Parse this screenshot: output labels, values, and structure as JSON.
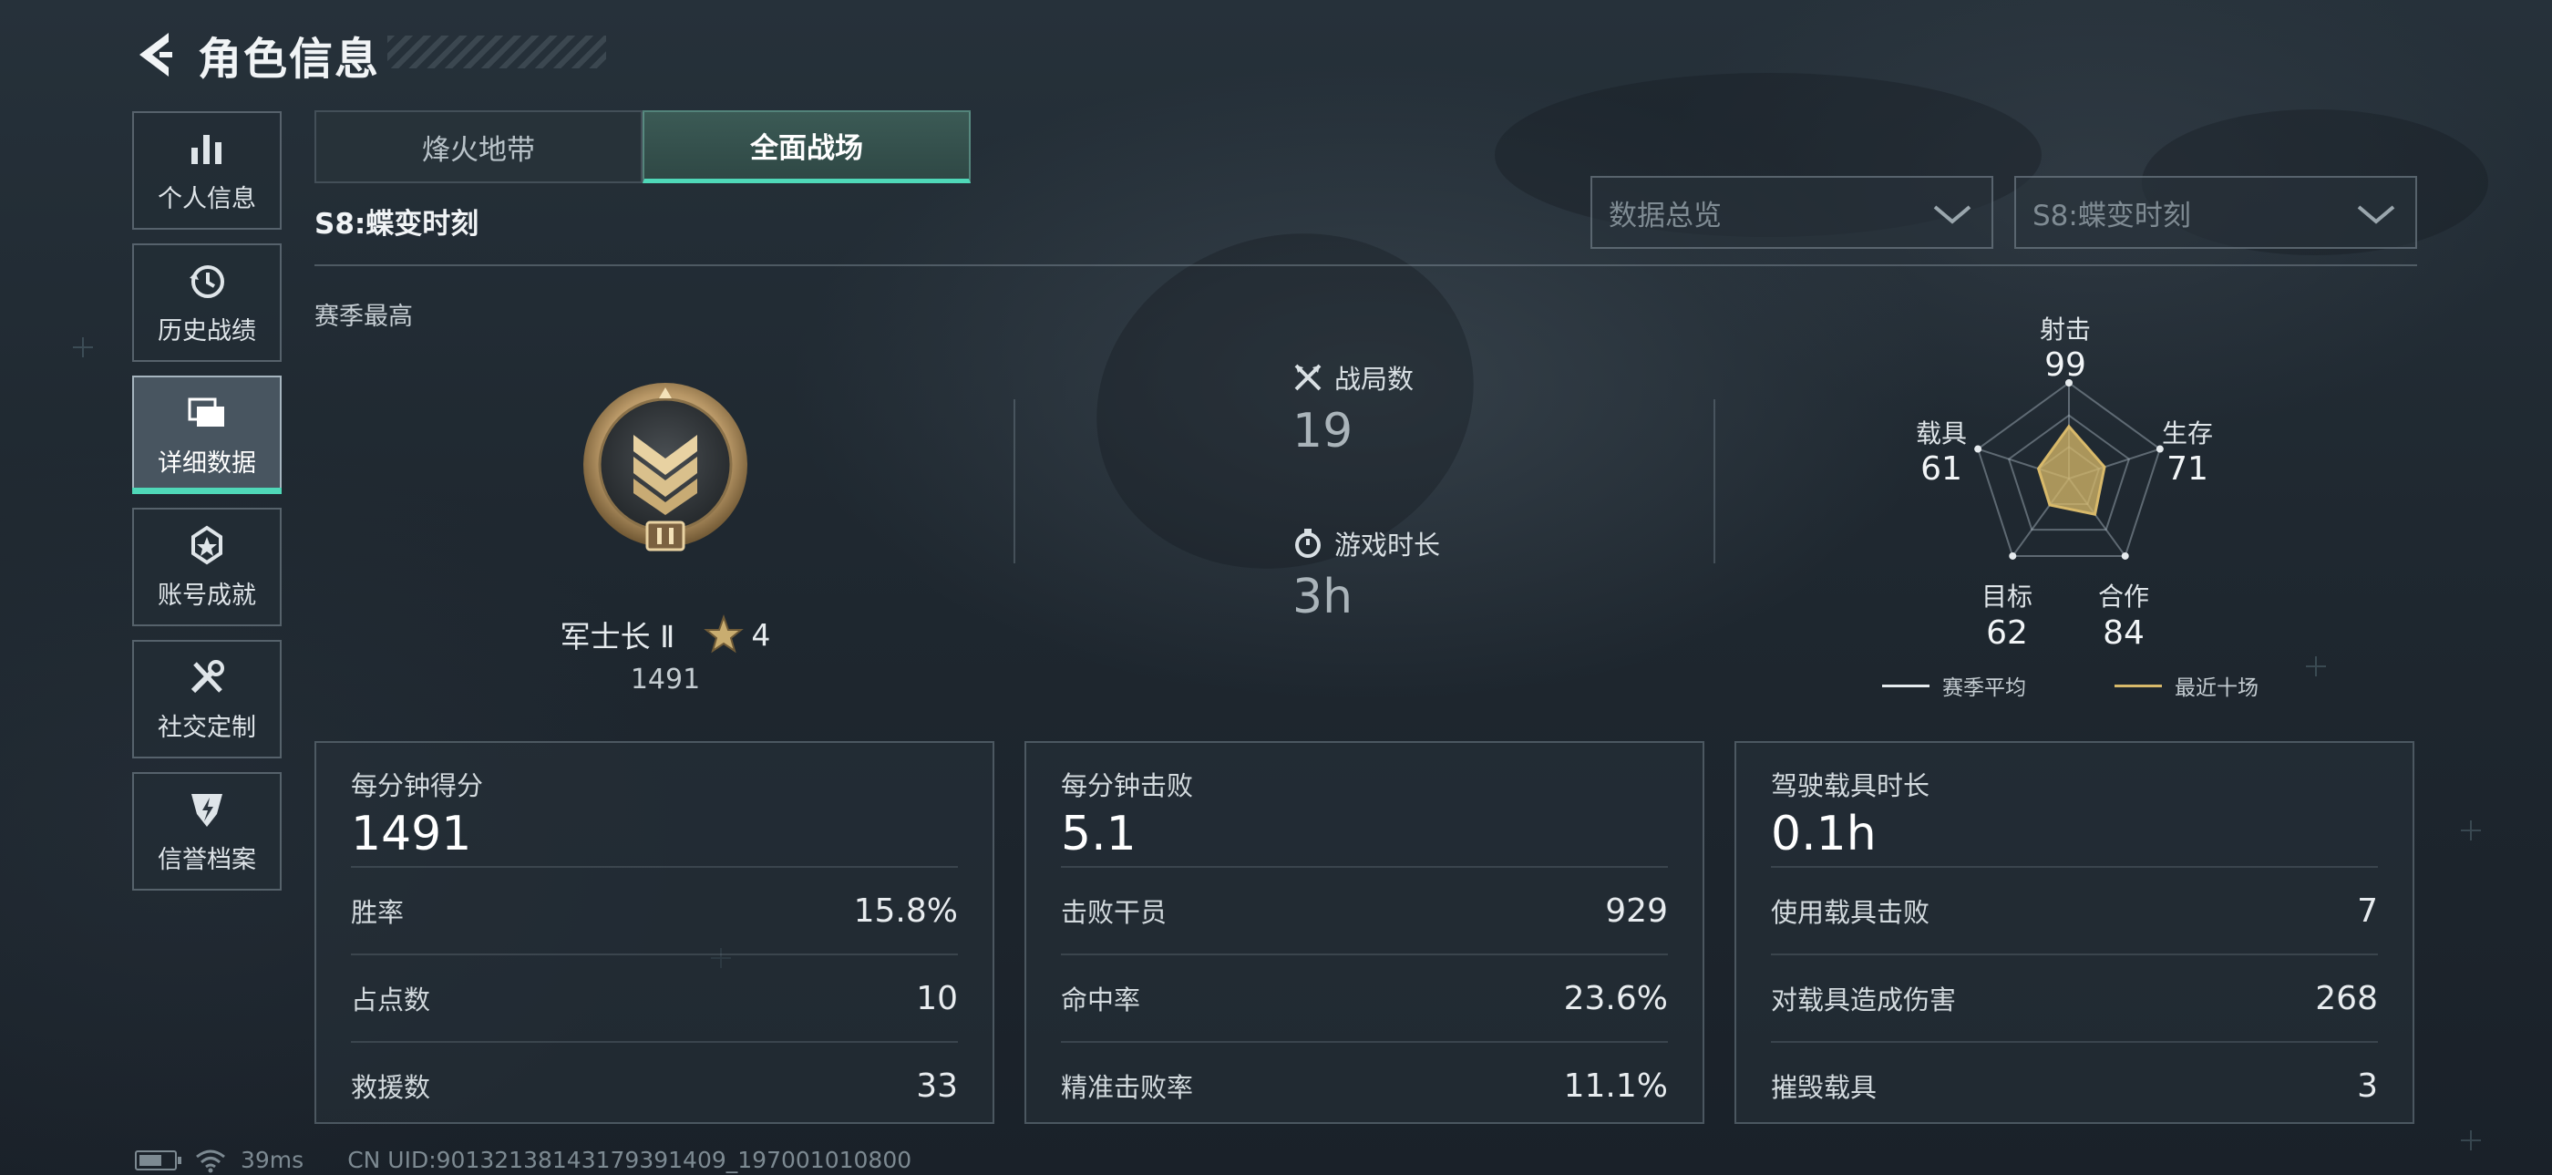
{
  "header": {
    "title": "角色信息"
  },
  "sidebar": {
    "items": [
      {
        "label": "个人信息",
        "icon": "bar-chart-icon"
      },
      {
        "label": "历史战绩",
        "icon": "history-icon"
      },
      {
        "label": "详细数据",
        "icon": "folders-icon",
        "active": true
      },
      {
        "label": "账号成就",
        "icon": "medal-icon"
      },
      {
        "label": "社交定制",
        "icon": "tools-icon"
      },
      {
        "label": "信誉档案",
        "icon": "shield-badge-icon"
      }
    ]
  },
  "tabs": [
    {
      "label": "烽火地带",
      "active": false
    },
    {
      "label": "全面战场",
      "active": true
    }
  ],
  "season": {
    "title": "S8:蝶变时刻",
    "best_label": "赛季最高"
  },
  "filters": {
    "data_type": {
      "value": "数据总览"
    },
    "season": {
      "value": "S8:蝶变时刻"
    }
  },
  "rank": {
    "name": "军士长 Ⅱ",
    "stars": "4",
    "score": "1491"
  },
  "summary": {
    "matches_label": "战局数",
    "matches_value": "19",
    "playtime_label": "游戏时长",
    "playtime_value": "3h"
  },
  "radar": {
    "axes": [
      {
        "label": "射击",
        "value": "99"
      },
      {
        "label": "生存",
        "value": "71"
      },
      {
        "label": "合作",
        "value": "84"
      },
      {
        "label": "目标",
        "value": "62"
      },
      {
        "label": "载具",
        "value": "61"
      }
    ],
    "legend": {
      "season_avg": "赛季平均",
      "last_ten": "最近十场"
    },
    "colors": {
      "season_avg": "#e6ebee",
      "last_ten": "#d8b96a"
    }
  },
  "cards": [
    {
      "head_label": "每分钟得分",
      "head_value": "1491",
      "rows": [
        {
          "label": "胜率",
          "value": "15.8%"
        },
        {
          "label": "占点数",
          "value": "10"
        },
        {
          "label": "救援数",
          "value": "33"
        }
      ]
    },
    {
      "head_label": "每分钟击败",
      "head_value": "5.1",
      "rows": [
        {
          "label": "击败干员",
          "value": "929"
        },
        {
          "label": "命中率",
          "value": "23.6%"
        },
        {
          "label": "精准击败率",
          "value": "11.1%"
        }
      ]
    },
    {
      "head_label": "驾驶载具时长",
      "head_value": "0.1h",
      "rows": [
        {
          "label": "使用载具击败",
          "value": "7"
        },
        {
          "label": "对载具造成伤害",
          "value": "268"
        },
        {
          "label": "摧毁载具",
          "value": "3"
        }
      ]
    }
  ],
  "footer": {
    "ping": "39ms",
    "uid": "CN UID:90132138143179391409_197001010800"
  },
  "colors": {
    "accent": "#4fd8b8",
    "gold": "#d8b96a"
  }
}
